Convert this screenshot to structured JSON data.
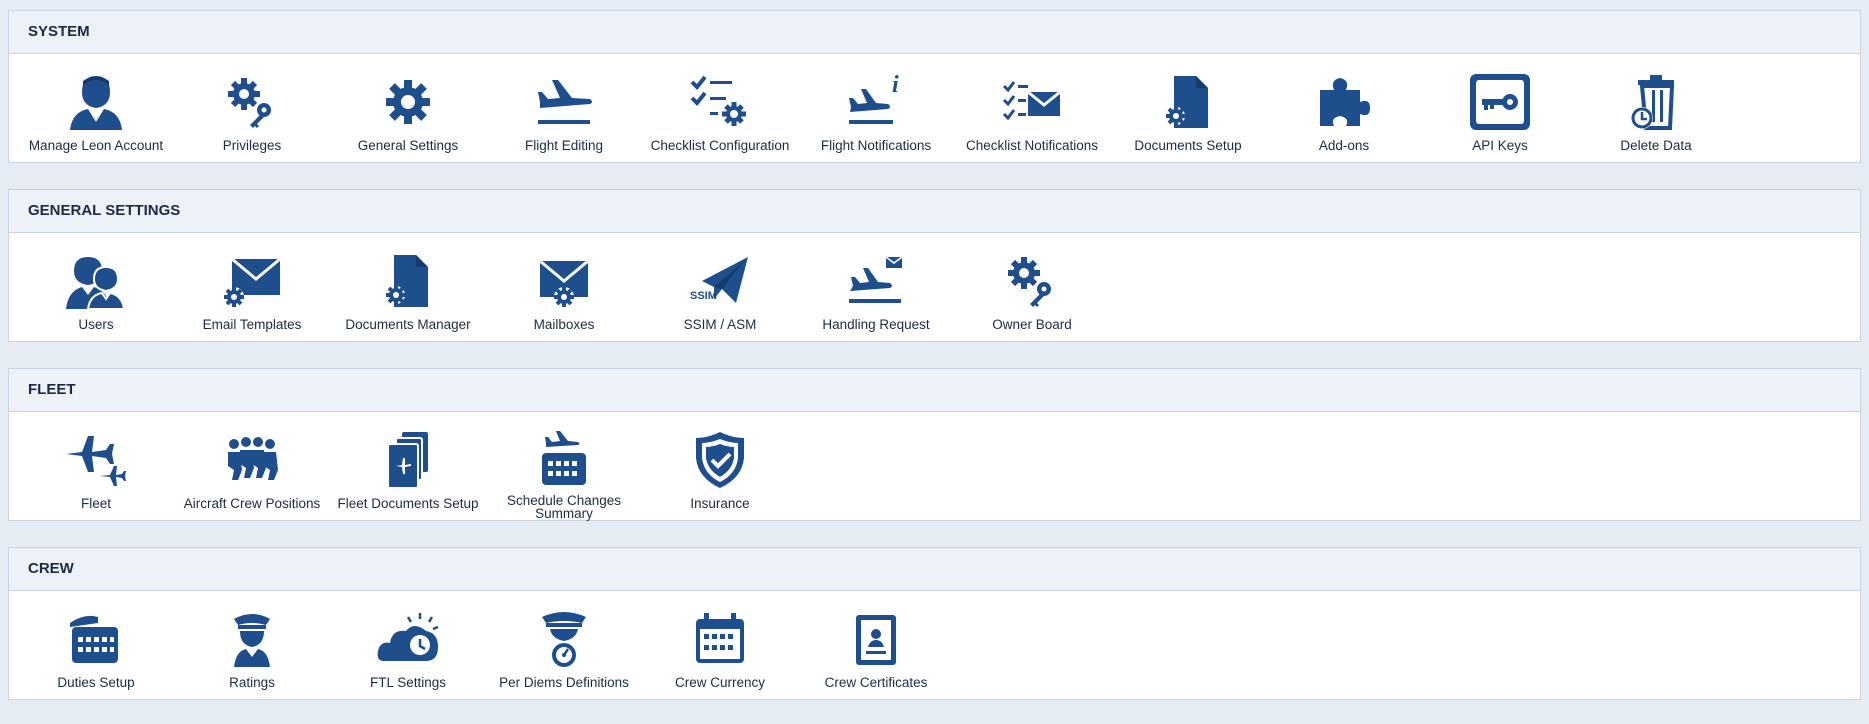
{
  "colors": {
    "icon": "#1f4e8c",
    "header_bg": "#edf2f9",
    "page_bg": "#e6ecf4",
    "border": "#c9d4e3"
  },
  "sections": [
    {
      "title": "SYSTEM",
      "items": [
        {
          "label": "Manage Leon Account",
          "icon": "user-icon"
        },
        {
          "label": "Privileges",
          "icon": "gears-key-icon"
        },
        {
          "label": "General Settings",
          "icon": "gear-icon"
        },
        {
          "label": "Flight Editing",
          "icon": "plane-takeoff-icon"
        },
        {
          "label": "Checklist Configuration",
          "icon": "checklist-gear-icon"
        },
        {
          "label": "Flight Notifications",
          "icon": "plane-info-icon"
        },
        {
          "label": "Checklist Notifications",
          "icon": "checklist-envelope-icon"
        },
        {
          "label": "Documents Setup",
          "icon": "document-gear-icon"
        },
        {
          "label": "Add-ons",
          "icon": "puzzle-icon"
        },
        {
          "label": "API Keys",
          "icon": "key-icon"
        },
        {
          "label": "Delete Data",
          "icon": "trash-clock-icon"
        }
      ]
    },
    {
      "title": "GENERAL SETTINGS",
      "items": [
        {
          "label": "Users",
          "icon": "users-icon"
        },
        {
          "label": "Email Templates",
          "icon": "envelope-gear-icon"
        },
        {
          "label": "Documents Manager",
          "icon": "document-gear-icon"
        },
        {
          "label": "Mailboxes",
          "icon": "mailbox-gear-icon"
        },
        {
          "label": "SSIM / ASM",
          "icon": "ssim-paperplane-icon",
          "icon_text": "SSIM"
        },
        {
          "label": "Handling Request",
          "icon": "plane-envelope-icon"
        },
        {
          "label": "Owner Board",
          "icon": "gears-key-icon"
        }
      ]
    },
    {
      "title": "FLEET",
      "items": [
        {
          "label": "Fleet",
          "icon": "planes-icon"
        },
        {
          "label": "Aircraft Crew Positions",
          "icon": "crew-seats-icon"
        },
        {
          "label": "Fleet Documents Setup",
          "icon": "plane-documents-icon"
        },
        {
          "label": "Schedule Changes Summary",
          "icon": "plane-calendar-icon"
        },
        {
          "label": "Insurance",
          "icon": "shield-check-icon"
        }
      ]
    },
    {
      "title": "CREW",
      "items": [
        {
          "label": "Duties Setup",
          "icon": "pilot-calendar-icon"
        },
        {
          "label": "Ratings",
          "icon": "pilot-icon"
        },
        {
          "label": "FTL Settings",
          "icon": "cloud-clock-icon"
        },
        {
          "label": "Per Diems Definitions",
          "icon": "pilot-gauge-icon"
        },
        {
          "label": "Crew Currency",
          "icon": "calendar-icon"
        },
        {
          "label": "Crew Certificates",
          "icon": "certificate-icon"
        }
      ]
    }
  ]
}
